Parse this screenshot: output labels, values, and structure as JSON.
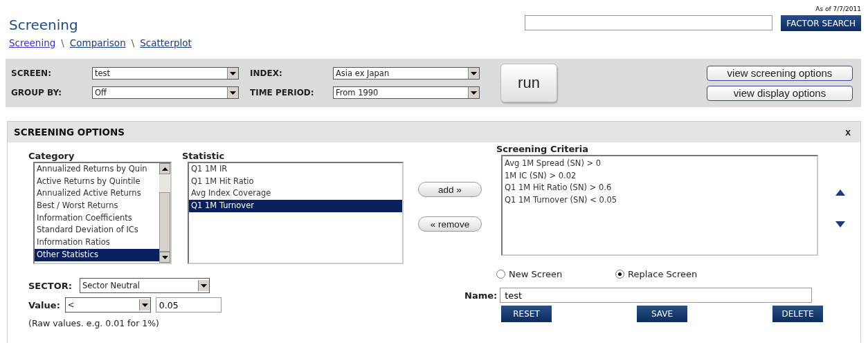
{
  "header": {
    "title": "Screening",
    "breadcrumbs": [
      {
        "label": "Screening",
        "visited": true
      },
      {
        "label": "Comparison",
        "visited": false
      },
      {
        "label": "Scatterplot",
        "visited": false
      }
    ],
    "separator": "\\",
    "as_of": "As of 7/7/2011",
    "search_button": "FACTOR SEARCH"
  },
  "toolbar": {
    "fields": [
      {
        "label": "SCREEN:",
        "value": "test"
      },
      {
        "label": "INDEX:",
        "value": "Asia ex Japan"
      },
      {
        "label": "GROUP BY:",
        "value": "Off"
      },
      {
        "label": "TIME PERIOD:",
        "value": "From 1990"
      }
    ],
    "run_button": "run",
    "option_buttons": [
      "view screening options",
      "view display options"
    ]
  },
  "panel": {
    "title": "SCREENING OPTIONS",
    "close": "x",
    "category": {
      "label": "Category",
      "items": [
        {
          "label": "Annualized Returns by Quin",
          "selected": false
        },
        {
          "label": "Active Returns by Quintile",
          "selected": false
        },
        {
          "label": "Annualized Active Returns",
          "selected": false
        },
        {
          "label": "Best / Worst Returns",
          "selected": false
        },
        {
          "label": "Information Coefficients",
          "selected": false
        },
        {
          "label": "Standard Deviation of ICs",
          "selected": false
        },
        {
          "label": "Information Ratios",
          "selected": false
        },
        {
          "label": "Other Statistics",
          "selected": true
        }
      ]
    },
    "statistic": {
      "label": "Statistic",
      "items": [
        {
          "label": "Q1 1M IR",
          "selected": false
        },
        {
          "label": "Q1 1M Hit Ratio",
          "selected": false
        },
        {
          "label": "Avg Index Coverage",
          "selected": false
        },
        {
          "label": "Q1 1M Turnover",
          "selected": true
        }
      ]
    },
    "add_button": "add »",
    "remove_button": "« remove",
    "criteria": {
      "label": "Screening Criteria",
      "items": [
        "Avg 1M Spread (SN) > 0",
        "1M IC (SN) > 0.02",
        "Q1 1M Hit Ratio (SN) > 0.6",
        "Q1 1M Turnover (SN) < 0.05"
      ]
    },
    "sector": {
      "label": "SECTOR:",
      "value": "Sector Neutral"
    },
    "value": {
      "label": "Value:",
      "operator": "<",
      "value": "0.05"
    },
    "note": "(Raw values. e.g. 0.01 for 1%)",
    "save_mode": [
      {
        "label": "New Screen",
        "selected": false
      },
      {
        "label": "Replace Screen",
        "selected": true
      }
    ],
    "name": {
      "label": "Name:",
      "value": "test"
    },
    "actions": [
      "RESET",
      "SAVE",
      "DELETE"
    ]
  }
}
